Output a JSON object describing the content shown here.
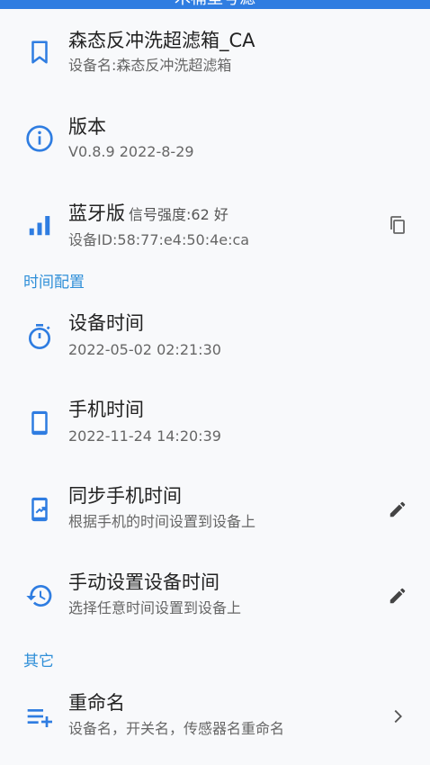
{
  "header": {
    "title": "木桶型号滤"
  },
  "device": {
    "title": "森态反冲洗超滤箱_CA",
    "subtitle": "设备名:森态反冲洗超滤箱"
  },
  "version": {
    "title": "版本",
    "subtitle": "V0.8.9 2022-8-29"
  },
  "bluetooth": {
    "title": "蓝牙版",
    "signal": "信号强度:62 好",
    "subtitle": "设备ID:58:77:e4:50:4e:ca"
  },
  "time_section": {
    "header": "时间配置",
    "device_time": {
      "title": "设备时间",
      "value": "2022-05-02 02:21:30"
    },
    "phone_time": {
      "title": "手机时间",
      "value": "2022-11-24 14:20:39"
    },
    "sync_phone_time": {
      "title": "同步手机时间",
      "subtitle": "根据手机的时间设置到设备上"
    },
    "manual_set_time": {
      "title": "手动设置设备时间",
      "subtitle": "选择任意时间设置到设备上"
    }
  },
  "other_section": {
    "header": "其它",
    "rename": {
      "title": "重命名",
      "subtitle": "设备名，开关名，传感器名重命名"
    }
  },
  "colors": {
    "accent": "#2f7de1",
    "section": "#2f8fd8",
    "icon": "#2f7de1"
  }
}
